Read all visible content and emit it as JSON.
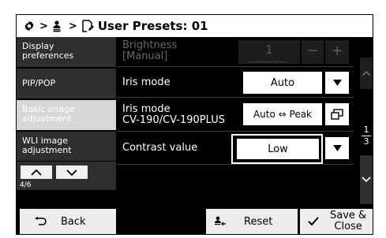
{
  "header": {
    "title": "User Presets: 01",
    "separator": ">"
  },
  "sidebar": {
    "items": [
      {
        "label_line1": "Display",
        "label_line2": "preferences"
      },
      {
        "label_line1": "PIP/POP",
        "label_line2": ""
      },
      {
        "label_line1": "Basic image",
        "label_line2": "adjustment"
      },
      {
        "label_line1": "WLI image",
        "label_line2": "adjustment"
      }
    ],
    "page_indicator": "4/6"
  },
  "settings": {
    "brightness": {
      "label_line1": "Brightness",
      "label_line2": "[Manual]",
      "value": "1",
      "minus": "−",
      "plus": "+"
    },
    "iris_mode": {
      "label": "Iris mode",
      "value": "Auto"
    },
    "iris_mode_cv": {
      "label_line1": "Iris mode",
      "label_line2": "CV-190/CV-190PLUS",
      "value": "Auto ⇔ Peak"
    },
    "contrast": {
      "label": "Contrast value",
      "value": "Low"
    }
  },
  "pagination": {
    "current": "1",
    "total": "3"
  },
  "footer": {
    "back_label": "Back",
    "reset_label": "Reset",
    "save_line1": "Save &",
    "save_line2": "Close"
  }
}
